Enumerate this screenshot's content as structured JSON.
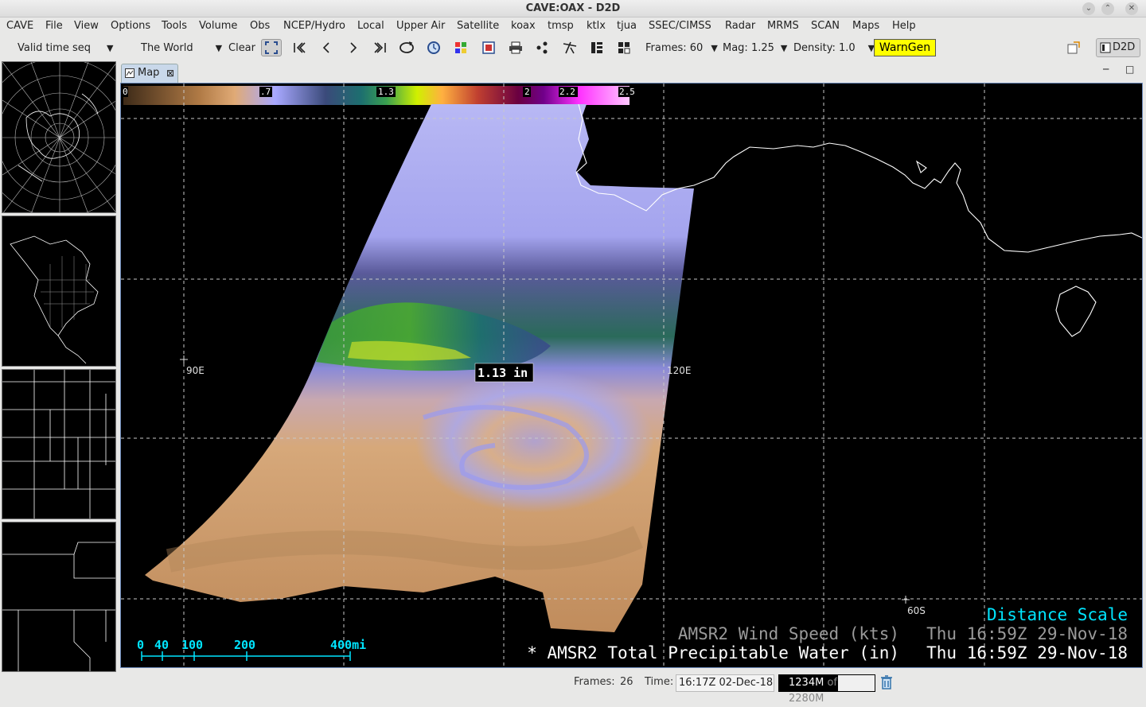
{
  "window": {
    "title": "CAVE:OAX - D2D"
  },
  "menu": [
    "CAVE",
    "File",
    "View",
    "Options",
    "Tools",
    "Volume",
    "Obs",
    "NCEP/Hydro",
    "Local",
    "Upper Air",
    "Satellite",
    "koax",
    "tmsp",
    "ktlx",
    "tjua",
    "SSEC/CIMSS",
    "Radar",
    "MRMS",
    "SCAN",
    "Maps",
    "Help"
  ],
  "toolbar": {
    "time_mode": "Valid time seq",
    "area": "The World",
    "clear": "Clear",
    "frames": "Frames: 60",
    "mag": "Mag: 1.25",
    "density": "Density: 1.0",
    "warngen": "WarnGen",
    "perspective": "D2D"
  },
  "map": {
    "tab_label": "Map",
    "colorbar_labels": [
      "0",
      ".7",
      "1.3",
      "2",
      "2.2",
      "2.5"
    ],
    "colorbar_colors": [
      "#6b4a2a",
      "#d9a46c",
      "#a9a9ff",
      "#1f6c6c",
      "#c8e000",
      "#ff9a3c",
      "#7a0080",
      "#ff77ff"
    ],
    "lon_labels": [
      "90E",
      "120E"
    ],
    "lat_label": "60S",
    "sample_readout": "1.13 in",
    "distance_scale_title": "Distance Scale",
    "scale_ticks": [
      "0",
      "40",
      "100",
      "200",
      "400mi"
    ],
    "legend_line1_product": "AMSR2 Wind Speed (kts)",
    "legend_line1_time": "Thu 16:59Z 29-Nov-18",
    "legend_line2_product": "* AMSR2 Total Precipitable Water (in)",
    "legend_line2_time": "Thu 16:59Z 29-Nov-18",
    "colors": {
      "cyan_text": "#00e5ff",
      "dim_legend": "#9a9a9a",
      "active_legend": "#ffffff"
    }
  },
  "status": {
    "frames_label": "Frames:",
    "frames_value": "26",
    "time_label": "Time:",
    "time_value": "16:17Z 02-Dec-18",
    "memory_used": "1234M",
    "memory_of": "of",
    "memory_total": "2280M"
  }
}
